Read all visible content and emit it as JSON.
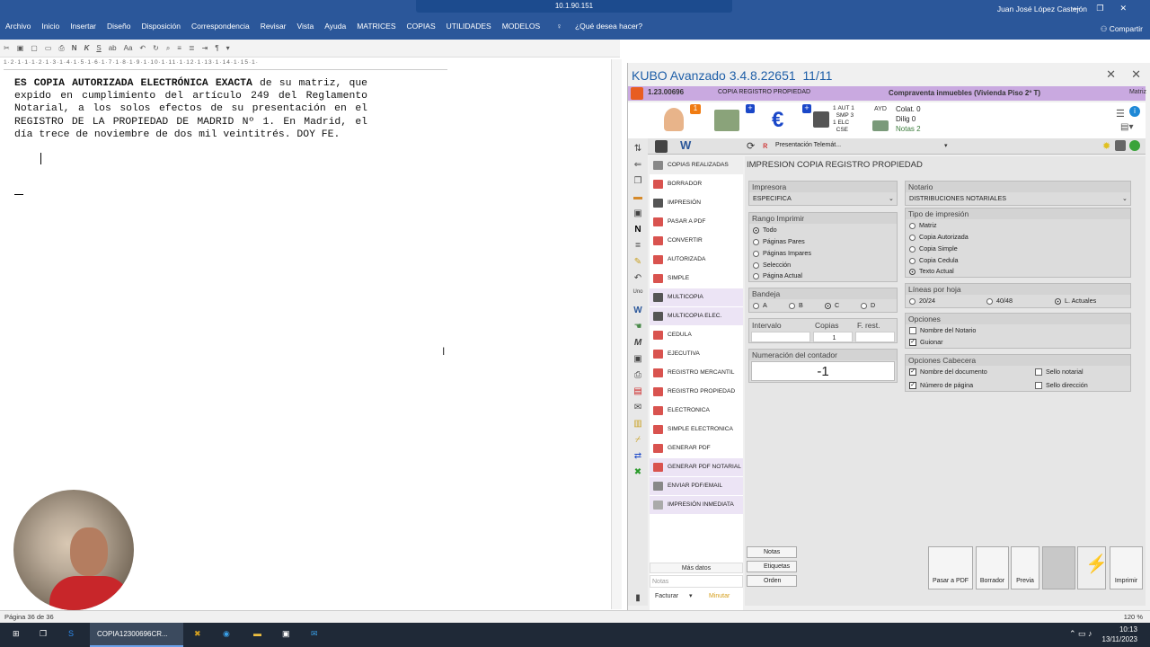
{
  "word": {
    "ribbon_menu": [
      "Archivo",
      "Inicio",
      "Insertar",
      "Diseño",
      "Disposición",
      "Correspondencia",
      "Revisar",
      "Vista",
      "Ayuda",
      "MATRICES",
      "COPIAS",
      "UTILIDADES",
      "MODELOS"
    ],
    "tell_me": "¿Qué desea hacer?",
    "remote_address": "10.1.90.151",
    "user_name": "Juan José López Castejón",
    "share": "Compartir",
    "ruler_ticks": "1·2·1·1·1·2·1·3·1·4·1·5·1·6·1·7·1·8·1·9·1·10·1·11·1·12·1·13·1·14·1·15·1·",
    "doc_bold": "ES COPIA AUTORIZADA ELECTRÓNICA EXACTA",
    "doc_rest": " de su matriz, que expido en cumplimiento del artículo 249 del Reglamento Notarial, a los solos efectos de su presentación en el REGISTRO DE LA PROPIEDAD DE MADRID Nº 1. En Madrid, el día trece de noviembre de dos mil veintitrés. DOY FE.",
    "status_page": "Página 36 de 36",
    "zoom": "120 %"
  },
  "taskbar": {
    "active_app": "COPIA12300696CR...",
    "time": "10:13",
    "date": "13/11/2023"
  },
  "kubo": {
    "title": "KUBO Avanzado 3.4.8.22651",
    "page_counter": "11/11",
    "code": "1.23.00696",
    "copia_registro": "COPIA REGISTRO PROPIEDAD",
    "description": "Compraventa inmuebles (Vivienda Piso 2º T)",
    "matriz": "Matriz",
    "badge_1": "1",
    "aut_lines": [
      "AUT",
      "SMP",
      "ELC",
      "CSE"
    ],
    "aut_values": [
      "1",
      "3",
      "1",
      ""
    ],
    "colat": "Colat. 0",
    "dilig": "Dilig 0",
    "notas": "Notas 2",
    "ayd": "AYD",
    "presentacion": "Presentación Telemát...",
    "menu": [
      "COPIAS REALIZADAS",
      "BORRADOR",
      "IMPRESIÓN",
      "PASAR A PDF",
      "CONVERTIR",
      "AUTORIZADA",
      "SIMPLE",
      "MULTICOPIA",
      "MULTICOPIA ELEC.",
      "CEDULA",
      "EJECUTIVA",
      "REGISTRO MERCANTIL",
      "REGISTRO PROPIEDAD",
      "ELECTRONICA",
      "SIMPLE ELECTRONICA",
      "GENERAR PDF",
      "GENERAR PDF NOTARIAL",
      "ENVIAR PDF/EMAIL",
      "IMPRESIÓN INMEDIATA"
    ],
    "mas_datos": "Más datos",
    "notas_placeholder": "Notas",
    "facturar": "Facturar",
    "minutar": "Minutar",
    "panel_title": "IMPRESION COPIA REGISTRO PROPIEDAD",
    "impresora_label": "Impresora",
    "impresora_value": "ESPECIFICA",
    "rango_label": "Rango Imprimir",
    "rango_options": [
      "Todo",
      "Páginas Pares",
      "Páginas Impares",
      "Selección",
      "Página Actual"
    ],
    "bandeja_label": "Bandeja",
    "bandeja_options": [
      "A",
      "B",
      "C",
      "D"
    ],
    "intervalo_label": "Intervalo",
    "copias_label": "Copias",
    "copias_value": "1",
    "frest_label": "F. rest.",
    "numeracion_label": "Numeración del contador",
    "numeracion_value": "-1",
    "notario_label": "Notario",
    "notario_value": "DISTRIBUCIONES NOTARIALES",
    "tipo_label": "Tipo de impresión",
    "tipo_options": [
      "Matriz",
      "Copia Autorizada",
      "Copia Simple",
      "Copia Cedula",
      "Texto Actual"
    ],
    "lineas_label": "Líneas por hoja",
    "lineas_options": [
      "20/24",
      "40/48",
      "L. Actuales"
    ],
    "opciones_label": "Opciones",
    "opciones_items": [
      "Nombre del Notario",
      "Guionar"
    ],
    "cabecera_label": "Opciones Cabecera",
    "cabecera_items": [
      "Nombre del documento",
      "Número de página",
      "Sello notarial",
      "Sello dirección"
    ],
    "bottom_small": [
      "Notas",
      "Etiquetas",
      "Orden"
    ],
    "bottom_big": [
      "Pasar a PDF",
      "Borrador",
      "Previa",
      "",
      "",
      "Imprimir"
    ]
  },
  "colors": {
    "word_blue": "#2b579a",
    "kubo_purple": "#c9a9e0",
    "kubo_title": "#1f5fa8",
    "pdf_red": "#d9534f"
  }
}
